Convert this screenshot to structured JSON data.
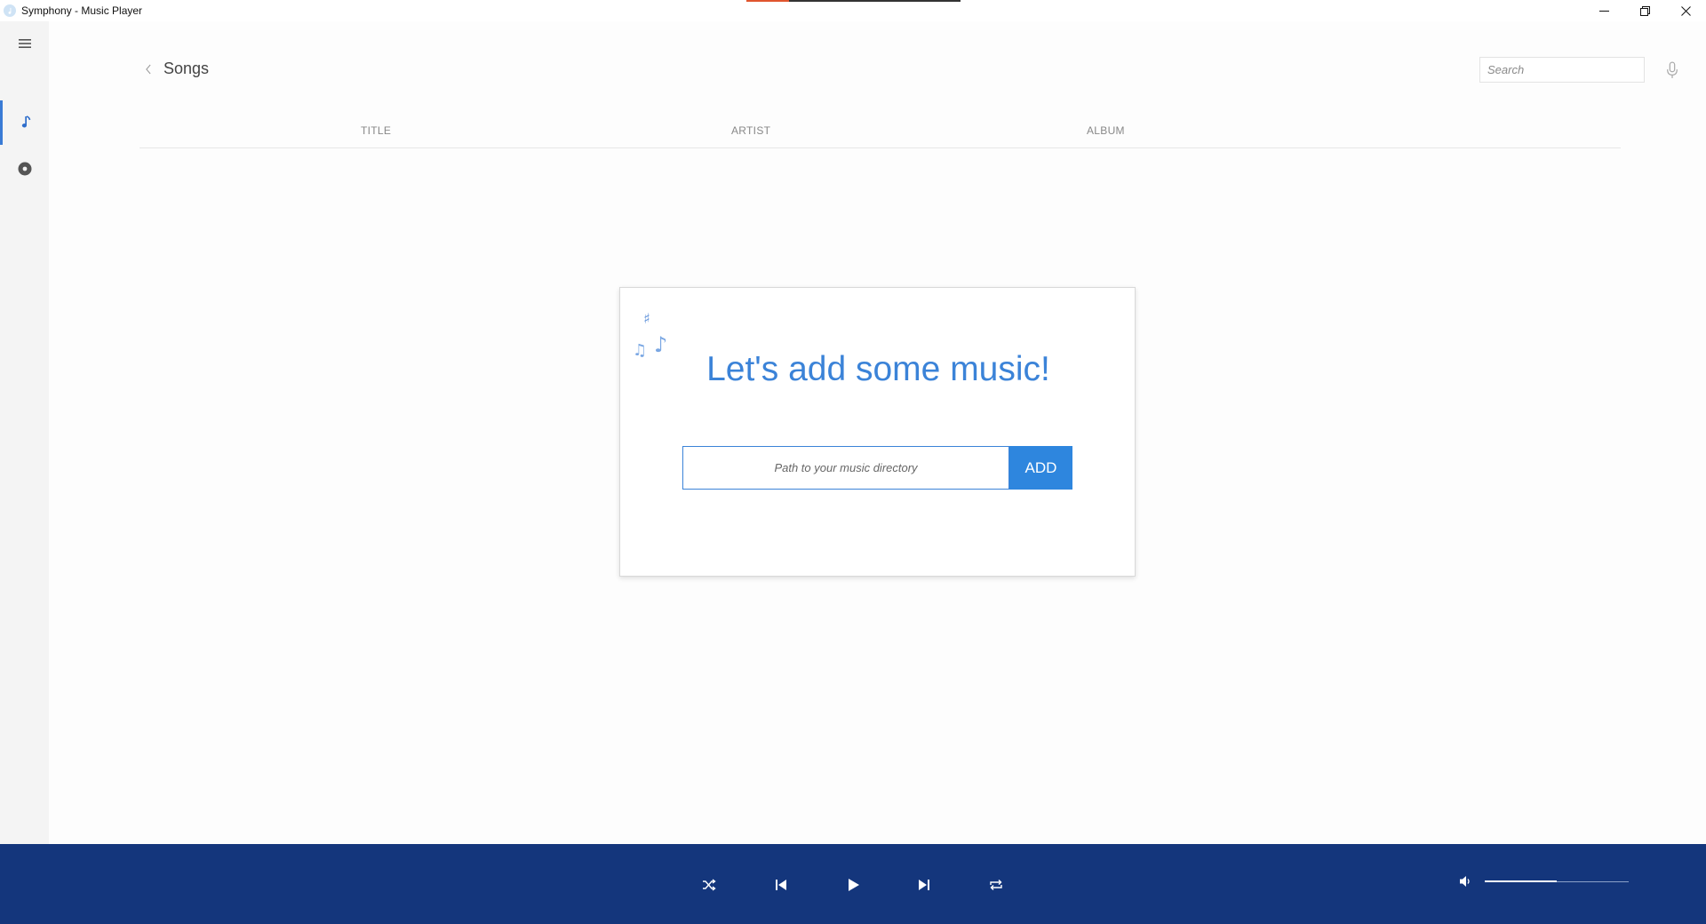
{
  "window": {
    "title": "Symphony - Music Player",
    "icon": "music-note-icon",
    "controls": [
      "minimize-icon",
      "restore-icon",
      "close-icon"
    ]
  },
  "sidebar": {
    "items": [
      {
        "icon": "hamburger-menu-icon"
      },
      {
        "icon": "music-note-icon",
        "active": true
      },
      {
        "icon": "disc-icon"
      }
    ]
  },
  "header": {
    "title": "Songs",
    "search": {
      "placeholder": "Search",
      "value": ""
    }
  },
  "columns": [
    "TITLE",
    "ARTIST",
    "ALBUM"
  ],
  "empty_state": {
    "heading": "Let's add some music!",
    "path_placeholder": "Path to your music directory",
    "path_value": "",
    "add_label": "ADD"
  },
  "player": {
    "controls": [
      "shuffle-icon",
      "previous-icon",
      "play-icon",
      "next-icon",
      "repeat-icon"
    ],
    "volume": 0.5
  },
  "colors": {
    "accent": "#3b83d8",
    "add_button": "#2e86de",
    "player_bar": "#14367c",
    "sidebar": "#f4f4f4"
  }
}
